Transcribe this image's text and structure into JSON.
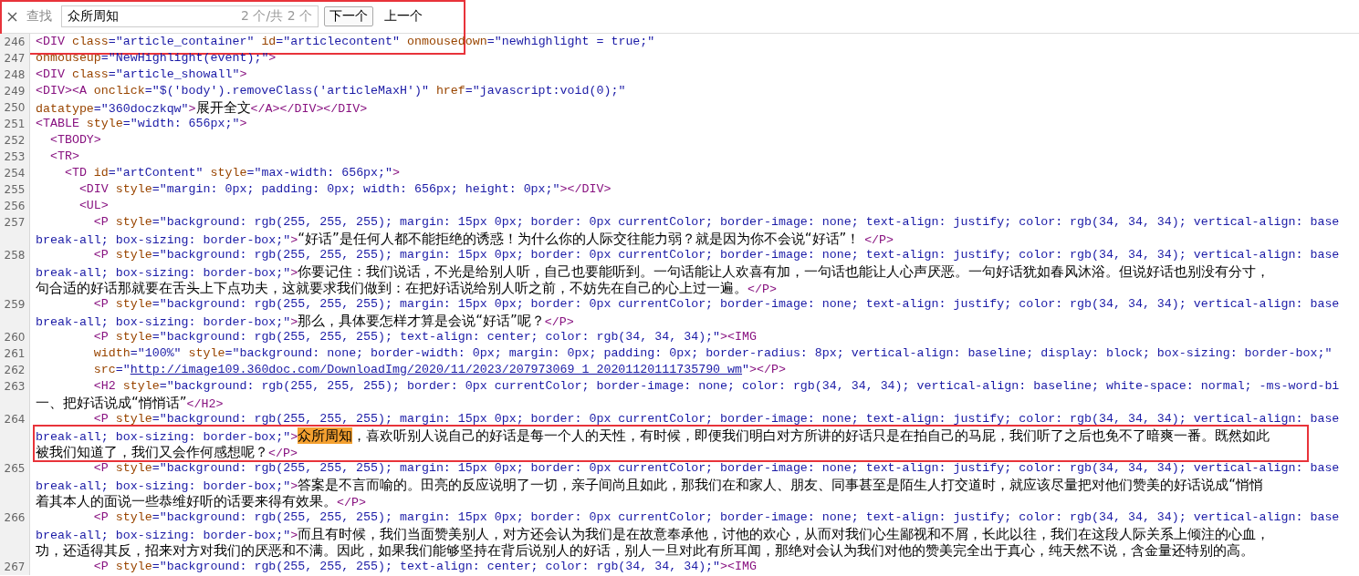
{
  "find_bar": {
    "label": "查找",
    "query": "众所周知",
    "match_count": "2 个/共 2 个",
    "framed": true,
    "buttons": [
      {
        "label": "下一个",
        "kind": "default"
      },
      {
        "label": "上一个",
        "kind": "flat"
      }
    ]
  },
  "lines": [
    {
      "number": "246",
      "framed": false,
      "rows": [
        {
          "segments": [
            {
              "kind": "tag",
              "text": "<DIV"
            },
            {
              "kind": "attr",
              "text": " class"
            },
            {
              "kind": "value",
              "text": "=\"article_container\""
            },
            {
              "kind": "attr",
              "text": " id"
            },
            {
              "kind": "value",
              "text": "=\"articlecontent\""
            },
            {
              "kind": "attr",
              "text": " onmousedown"
            },
            {
              "kind": "value",
              "text": "=\"newhighlight = true;\""
            }
          ]
        }
      ]
    },
    {
      "number": "247",
      "framed": false,
      "rows": [
        {
          "segments": [
            {
              "kind": "attr",
              "text": "onmouseup"
            },
            {
              "kind": "value",
              "text": "=\"NewHighlight(event);\""
            },
            {
              "kind": "tag",
              "text": ">"
            }
          ]
        }
      ]
    },
    {
      "number": "248",
      "framed": false,
      "rows": [
        {
          "segments": [
            {
              "kind": "tag",
              "text": "<DIV"
            },
            {
              "kind": "attr",
              "text": " class"
            },
            {
              "kind": "value",
              "text": "=\"article_showall\""
            },
            {
              "kind": "tag",
              "text": ">"
            }
          ]
        }
      ]
    },
    {
      "number": "249",
      "framed": false,
      "rows": [
        {
          "segments": [
            {
              "kind": "tag",
              "text": "<DIV><A"
            },
            {
              "kind": "attr",
              "text": " onclick"
            },
            {
              "kind": "value",
              "text": "=\"$('body').removeClass('articleMaxH')\""
            },
            {
              "kind": "attr",
              "text": " href"
            },
            {
              "kind": "value",
              "text": "=\"javascript:void(0);\""
            }
          ]
        }
      ]
    },
    {
      "number": "250",
      "framed": false,
      "rows": [
        {
          "segments": [
            {
              "kind": "attr",
              "text": "datatype"
            },
            {
              "kind": "value",
              "text": "=\"360doczkqw\""
            },
            {
              "kind": "tag",
              "text": ">"
            },
            {
              "kind": "text",
              "text": "展开全文"
            },
            {
              "kind": "tag",
              "text": "</A></DIV></DIV>"
            }
          ]
        }
      ]
    },
    {
      "number": "251",
      "framed": false,
      "rows": [
        {
          "segments": [
            {
              "kind": "tag",
              "text": "<TABLE"
            },
            {
              "kind": "attr",
              "text": " style"
            },
            {
              "kind": "value",
              "text": "=\"width: 656px;\""
            },
            {
              "kind": "tag",
              "text": ">"
            }
          ]
        }
      ]
    },
    {
      "number": "252",
      "framed": false,
      "rows": [
        {
          "segments": [
            {
              "kind": "tag",
              "text": "  <TBODY>"
            }
          ]
        }
      ]
    },
    {
      "number": "253",
      "framed": false,
      "rows": [
        {
          "segments": [
            {
              "kind": "tag",
              "text": "  <TR>"
            }
          ]
        }
      ]
    },
    {
      "number": "254",
      "framed": false,
      "rows": [
        {
          "segments": [
            {
              "kind": "tag",
              "text": "    <TD"
            },
            {
              "kind": "attr",
              "text": " id"
            },
            {
              "kind": "value",
              "text": "=\"artContent\""
            },
            {
              "kind": "attr",
              "text": " style"
            },
            {
              "kind": "value",
              "text": "=\"max-width: 656px;\""
            },
            {
              "kind": "tag",
              "text": ">"
            }
          ]
        }
      ]
    },
    {
      "number": "255",
      "framed": false,
      "rows": [
        {
          "segments": [
            {
              "kind": "tag",
              "text": "      <DIV"
            },
            {
              "kind": "attr",
              "text": " style"
            },
            {
              "kind": "value",
              "text": "=\"margin: 0px; padding: 0px; width: 656px; height: 0px;\""
            },
            {
              "kind": "tag",
              "text": "></DIV>"
            }
          ]
        }
      ]
    },
    {
      "number": "256",
      "framed": false,
      "rows": [
        {
          "segments": [
            {
              "kind": "tag",
              "text": "      <UL>"
            }
          ]
        }
      ]
    },
    {
      "number": "257",
      "framed": false,
      "rows": [
        {
          "segments": [
            {
              "kind": "tag",
              "text": "        <P"
            },
            {
              "kind": "attr",
              "text": " style"
            },
            {
              "kind": "value",
              "text": "=\"background: rgb(255, 255, 255); margin: 15px 0px; border: 0px currentColor; border-image: none; text-align: justify; color: rgb(34, 34, 34); vertical-align: base"
            }
          ]
        },
        {
          "segments": [
            {
              "kind": "value",
              "text": "break-all; box-sizing: border-box;\""
            },
            {
              "kind": "tag",
              "text": ">"
            },
            {
              "kind": "text",
              "text": "“好话”是任何人都不能拒绝的诱惑！为什么你的人际交往能力弱？就是因为你不会说“好话”！ "
            },
            {
              "kind": "tag",
              "text": "</P>"
            }
          ]
        }
      ]
    },
    {
      "number": "258",
      "framed": false,
      "rows": [
        {
          "segments": [
            {
              "kind": "tag",
              "text": "        <P"
            },
            {
              "kind": "attr",
              "text": " style"
            },
            {
              "kind": "value",
              "text": "=\"background: rgb(255, 255, 255); margin: 15px 0px; border: 0px currentColor; border-image: none; text-align: justify; color: rgb(34, 34, 34); vertical-align: base"
            }
          ]
        },
        {
          "segments": [
            {
              "kind": "value",
              "text": "break-all; box-sizing: border-box;\""
            },
            {
              "kind": "tag",
              "text": ">"
            },
            {
              "kind": "text",
              "text": "你要记住：我们说话，不光是给别人听，自己也要能听到。一句话能让人欢喜有加，一句话也能让人心声厌恶。一句好话犹如春风沐浴。但说好话也别没有分寸，"
            }
          ]
        },
        {
          "segments": [
            {
              "kind": "text",
              "text": "句合适的好话那就要在舌头上下点功夫，这就要求我们做到：在把好话说给别人听之前，不妨先在自己的心上过一遍。"
            },
            {
              "kind": "tag",
              "text": "</P>"
            }
          ]
        }
      ]
    },
    {
      "number": "259",
      "framed": false,
      "rows": [
        {
          "segments": [
            {
              "kind": "tag",
              "text": "        <P"
            },
            {
              "kind": "attr",
              "text": " style"
            },
            {
              "kind": "value",
              "text": "=\"background: rgb(255, 255, 255); margin: 15px 0px; border: 0px currentColor; border-image: none; text-align: justify; color: rgb(34, 34, 34); vertical-align: base"
            }
          ]
        },
        {
          "segments": [
            {
              "kind": "value",
              "text": "break-all; box-sizing: border-box;\""
            },
            {
              "kind": "tag",
              "text": ">"
            },
            {
              "kind": "text",
              "text": "那么，具体要怎样才算是会说“好话”呢？"
            },
            {
              "kind": "tag",
              "text": "</P>"
            }
          ]
        }
      ]
    },
    {
      "number": "260",
      "framed": false,
      "rows": [
        {
          "segments": [
            {
              "kind": "tag",
              "text": "        <P"
            },
            {
              "kind": "attr",
              "text": " style"
            },
            {
              "kind": "value",
              "text": "=\"background: rgb(255, 255, 255); text-align: center; color: rgb(34, 34, 34);\""
            },
            {
              "kind": "tag",
              "text": "><IMG"
            }
          ]
        }
      ]
    },
    {
      "number": "261",
      "framed": false,
      "rows": [
        {
          "segments": [
            {
              "kind": "attr",
              "text": "        width"
            },
            {
              "kind": "value",
              "text": "=\"100%\""
            },
            {
              "kind": "attr",
              "text": " style"
            },
            {
              "kind": "value",
              "text": "=\"background: none; border-width: 0px; margin: 0px; padding: 0px; border-radius: 8px; vertical-align: baseline; display: block; box-sizing: border-box;\""
            }
          ]
        }
      ]
    },
    {
      "number": "262",
      "framed": false,
      "rows": [
        {
          "segments": [
            {
              "kind": "attr",
              "text": "        src"
            },
            {
              "kind": "value",
              "text": "=\""
            },
            {
              "kind": "link",
              "text": "http://image109.360doc.com/DownloadImg/2020/11/2023/207973069_1_20201120111735790_wm"
            },
            {
              "kind": "value",
              "text": "\""
            },
            {
              "kind": "tag",
              "text": "></P>"
            }
          ]
        }
      ]
    },
    {
      "number": "263",
      "framed": false,
      "rows": [
        {
          "segments": [
            {
              "kind": "tag",
              "text": "        <H2"
            },
            {
              "kind": "attr",
              "text": " style"
            },
            {
              "kind": "value",
              "text": "=\"background: rgb(255, 255, 255); border: 0px currentColor; border-image: none; color: rgb(34, 34, 34); vertical-align: baseline; white-space: normal; -ms-word-bi"
            }
          ]
        },
        {
          "segments": [
            {
              "kind": "text",
              "text": "一、把好话说成“悄悄话”"
            },
            {
              "kind": "tag",
              "text": "</H2>"
            }
          ]
        }
      ]
    },
    {
      "number": "264",
      "framed": true,
      "rows": [
        {
          "segments": [
            {
              "kind": "tag",
              "text": "        <P"
            },
            {
              "kind": "attr",
              "text": " style"
            },
            {
              "kind": "value",
              "text": "=\"background: rgb(255, 255, 255); margin: 15px 0px; border: 0px currentColor; border-image: none; text-align: justify; color: rgb(34, 34, 34); vertical-align: base"
            }
          ]
        },
        {
          "segments": [
            {
              "kind": "value",
              "text": "break-all; box-sizing: border-box;\""
            },
            {
              "kind": "tag",
              "text": ">"
            },
            {
              "kind": "match",
              "text": "众所周知"
            },
            {
              "kind": "text",
              "text": "，喜欢听别人说自己的好话是每一个人的天性，有时候，即便我们明白对方所讲的好话只是在拍自己的马屁，我们听了之后也免不了暗爽一番。既然如此"
            }
          ]
        },
        {
          "segments": [
            {
              "kind": "text",
              "text": "被我们知道了，我们又会作何感想呢？"
            },
            {
              "kind": "tag",
              "text": "</P>"
            }
          ]
        }
      ]
    },
    {
      "number": "265",
      "framed": false,
      "rows": [
        {
          "segments": [
            {
              "kind": "tag",
              "text": "        <P"
            },
            {
              "kind": "attr",
              "text": " style"
            },
            {
              "kind": "value",
              "text": "=\"background: rgb(255, 255, 255); margin: 15px 0px; border: 0px currentColor; border-image: none; text-align: justify; color: rgb(34, 34, 34); vertical-align: base"
            }
          ]
        },
        {
          "segments": [
            {
              "kind": "value",
              "text": "break-all; box-sizing: border-box;\""
            },
            {
              "kind": "tag",
              "text": ">"
            },
            {
              "kind": "text",
              "text": "答案是不言而喻的。田亮的反应说明了一切，亲子间尚且如此，那我们在和家人、朋友、同事甚至是陌生人打交道时，就应该尽量把对他们赞美的好话说成“悄悄"
            }
          ]
        },
        {
          "segments": [
            {
              "kind": "text",
              "text": "着其本人的面说一些恭维好听的话要来得有效果。"
            },
            {
              "kind": "tag",
              "text": "</P>"
            }
          ]
        }
      ]
    },
    {
      "number": "266",
      "framed": false,
      "rows": [
        {
          "segments": [
            {
              "kind": "tag",
              "text": "        <P"
            },
            {
              "kind": "attr",
              "text": " style"
            },
            {
              "kind": "value",
              "text": "=\"background: rgb(255, 255, 255); margin: 15px 0px; border: 0px currentColor; border-image: none; text-align: justify; color: rgb(34, 34, 34); vertical-align: base"
            }
          ]
        },
        {
          "segments": [
            {
              "kind": "value",
              "text": "break-all; box-sizing: border-box;\""
            },
            {
              "kind": "tag",
              "text": ">"
            },
            {
              "kind": "text",
              "text": "而且有时候，我们当面赞美别人，对方还会认为我们是在故意奉承他，讨他的欢心，从而对我们心生鄙视和不屑，长此以往，我们在这段人际关系上倾注的心血，"
            }
          ]
        },
        {
          "segments": [
            {
              "kind": "text",
              "text": "功，还适得其反，招来对方对我们的厌恶和不满。因此，如果我们能够坚持在背后说别人的好话，别人一旦对此有所耳闻，那绝对会认为我们对他的赞美完全出于真心，纯天然不说，含金量还特别的高。"
            }
          ]
        }
      ]
    },
    {
      "number": "267",
      "framed": false,
      "rows": [
        {
          "segments": [
            {
              "kind": "tag",
              "text": "        <P"
            },
            {
              "kind": "attr",
              "text": " style"
            },
            {
              "kind": "value",
              "text": "=\"background: rgb(255, 255, 255); text-align: center; color: rgb(34, 34, 34);\""
            },
            {
              "kind": "tag",
              "text": "><IMG"
            }
          ]
        }
      ]
    }
  ]
}
